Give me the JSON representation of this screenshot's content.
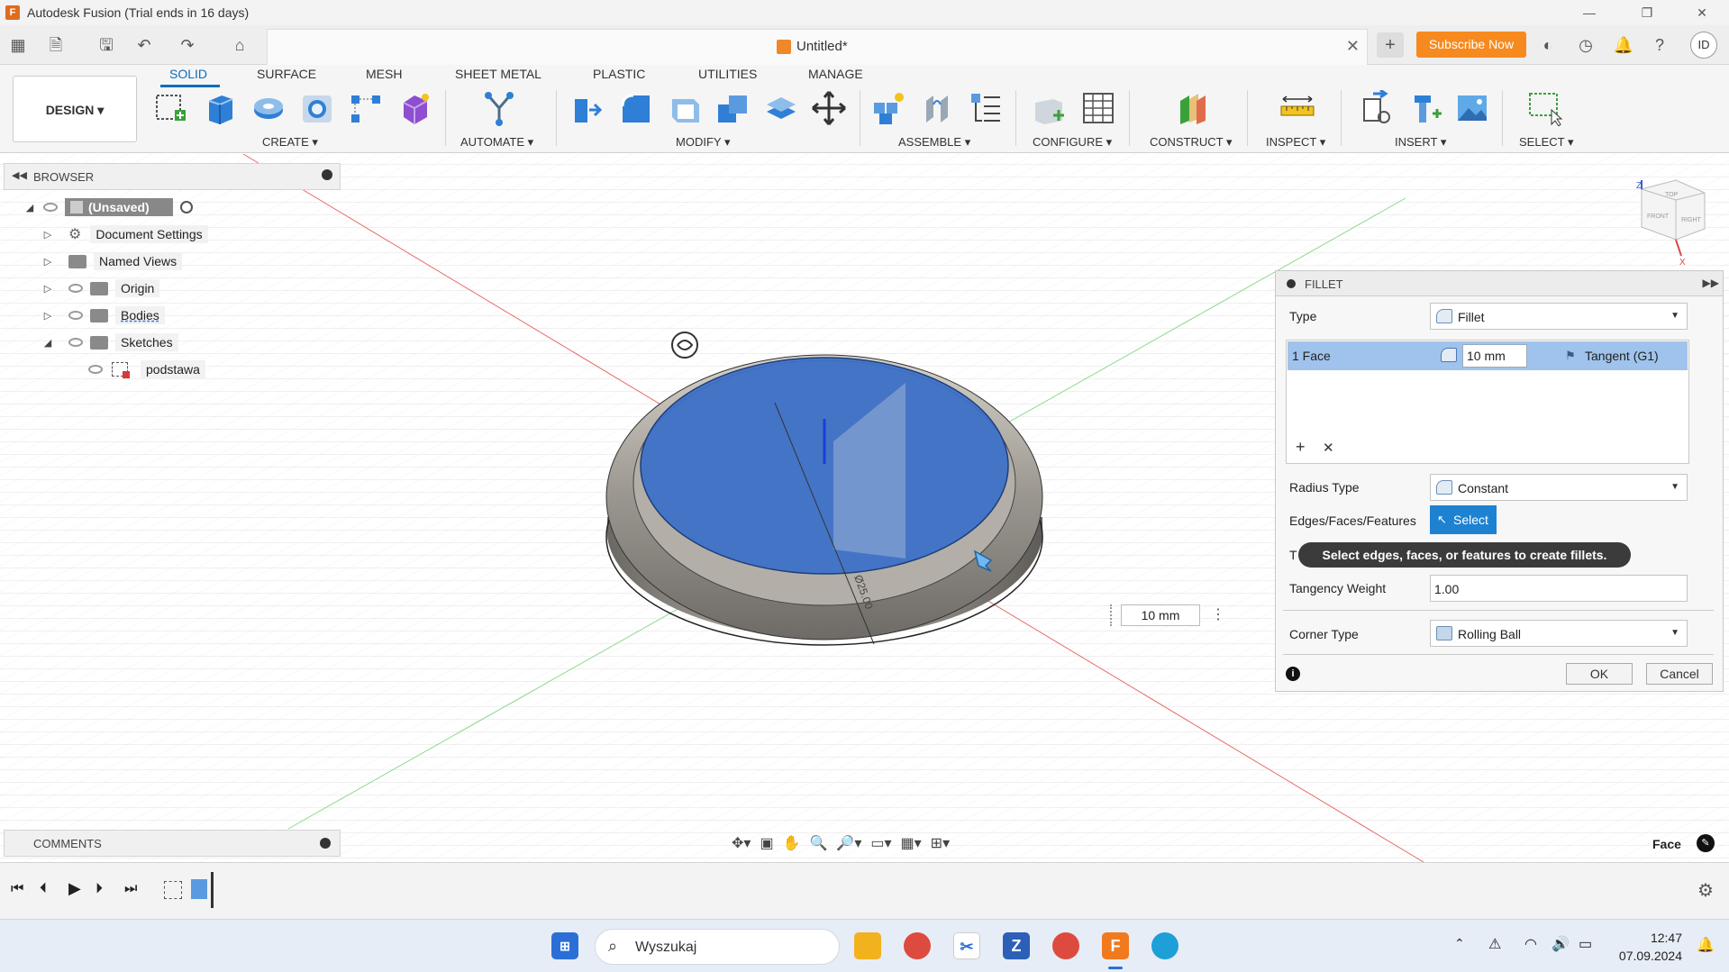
{
  "window": {
    "title": "Autodesk Fusion (Trial ends in 16 days)"
  },
  "document": {
    "title": "Untitled*"
  },
  "appbar": {
    "subscribe_label": "Subscribe Now",
    "avatar_initials": "ID"
  },
  "ribbon": {
    "workspace": "DESIGN",
    "tabs": [
      "SOLID",
      "SURFACE",
      "MESH",
      "SHEET METAL",
      "PLASTIC",
      "UTILITIES",
      "MANAGE"
    ],
    "groups": [
      "CREATE",
      "AUTOMATE",
      "MODIFY",
      "ASSEMBLE",
      "CONFIGURE",
      "CONSTRUCT",
      "INSPECT",
      "INSERT",
      "SELECT"
    ]
  },
  "browser": {
    "header": "BROWSER",
    "items": [
      {
        "label": "(Unsaved)"
      },
      {
        "label": "Document Settings"
      },
      {
        "label": "Named Views"
      },
      {
        "label": "Origin"
      },
      {
        "label": "Bodies"
      },
      {
        "label": "Sketches"
      },
      {
        "label": "podstawa"
      }
    ]
  },
  "comments": {
    "header": "COMMENTS"
  },
  "fillet": {
    "header": "FILLET",
    "type_label": "Type",
    "type_value": "Fillet",
    "row": {
      "selection": "1 Face",
      "radius": "10 mm",
      "continuity": "Tangent (G1)"
    },
    "radius_type_label": "Radius Type",
    "radius_type_value": "Constant",
    "edges_label": "Edges/Faces/Features",
    "select_btn": "Select",
    "partial_label": "T",
    "tangency_label": "Tangency Weight",
    "tangency_value": "1.00",
    "corner_label": "Corner Type",
    "corner_value": "Rolling Ball",
    "ok": "OK",
    "cancel": "Cancel"
  },
  "tooltip": "Select edges, faces, or features to create fillets.",
  "viewport": {
    "dim_value": "10 mm",
    "sketch_dim": "Ø25.00",
    "selection_filter": "Face"
  },
  "viewcube": {
    "top": "TOP",
    "front": "FRONT",
    "right": "RIGHT",
    "axis_z": "Z",
    "axis_x": "X"
  },
  "taskbar": {
    "search_placeholder": "Wyszukaj",
    "time": "12:47",
    "date": "07.09.2024"
  },
  "colors": {
    "accent": "#0a6ebd",
    "subscribe": "#f78a1e",
    "face_highlight": "#3b6fc9",
    "selection_row": "#9fc3ec"
  }
}
